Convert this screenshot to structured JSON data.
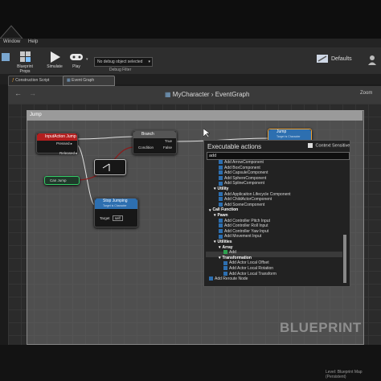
{
  "menu": [
    "Window",
    "Help"
  ],
  "toolbar": {
    "blueprint_props": "Blueprint Props",
    "simulate": "Simulate",
    "play": "Play",
    "debug_select": "No debug object selected",
    "debug_filter": "Debug Filter",
    "defaults": "Defaults"
  },
  "tabs": [
    "Construction Script",
    "Event Graph"
  ],
  "breadcrumb": {
    "root": "MyCharacter",
    "sep": "›",
    "leaf": "EventGraph"
  },
  "zoom_label": "Zoom",
  "comment": "Jump",
  "nodes": {
    "input_action": {
      "title": "InputAction Jump",
      "pressed": "Pressed",
      "released": "Released"
    },
    "branch": {
      "title": "Branch",
      "condition": "Condition",
      "true": "True",
      "false": "False"
    },
    "jump": {
      "title": "Jump",
      "subtitle": "Target is Character"
    },
    "stop_jumping": {
      "title": "Stop Jumping",
      "subtitle": "Target is Character",
      "target": "Target",
      "self": "self"
    },
    "can_jump": {
      "title": "Can Jump"
    }
  },
  "context_menu": {
    "title": "Executable actions",
    "context_sensitive": "Context Sensitive",
    "search": "add",
    "items": [
      {
        "text": "Add ArrowComponent",
        "level": 2,
        "type": "fn"
      },
      {
        "text": "Add BoxComponent",
        "level": 2,
        "type": "fn"
      },
      {
        "text": "Add CapsuleComponent",
        "level": 2,
        "type": "fn"
      },
      {
        "text": "Add SphereComponent",
        "level": 2,
        "type": "fn"
      },
      {
        "text": "Add SplineComponent",
        "level": 2,
        "type": "fn"
      },
      {
        "text": "Utility",
        "level": 1,
        "type": "hdr"
      },
      {
        "text": "Add Applicaiton Lifecycle Component",
        "level": 2,
        "type": "fn"
      },
      {
        "text": "Add ChildActorComponent",
        "level": 2,
        "type": "fn"
      },
      {
        "text": "Add SceneComponent",
        "level": 2,
        "type": "fn"
      },
      {
        "text": "Call Function",
        "level": 0,
        "type": "hdr"
      },
      {
        "text": "Pawn",
        "level": 1,
        "type": "hdr"
      },
      {
        "text": "Add Controller Pitch Input",
        "level": 2,
        "type": "fn"
      },
      {
        "text": "Add Controller Roll Input",
        "level": 2,
        "type": "fn"
      },
      {
        "text": "Add Controller Yaw Input",
        "level": 2,
        "type": "fn"
      },
      {
        "text": "Add Movement Input",
        "level": 2,
        "type": "fn"
      },
      {
        "text": "Utilities",
        "level": 1,
        "type": "hdr"
      },
      {
        "text": "Array",
        "level": 2,
        "type": "hdr"
      },
      {
        "text": "Add",
        "level": 3,
        "type": "fn"
      },
      {
        "text": "Transformation",
        "level": 2,
        "type": "hdr"
      },
      {
        "text": "Add Actor Local Offset",
        "level": 3,
        "type": "fn"
      },
      {
        "text": "Add Actor Local Rotation",
        "level": 3,
        "type": "fn"
      },
      {
        "text": "Add Actor Local Transform",
        "level": 3,
        "type": "fn"
      },
      {
        "text": "Add Reroute Node",
        "level": 0,
        "type": "fn"
      }
    ]
  },
  "watermark": "BLUEPRINT",
  "status": "Level: Blueprint Map (Persistent)",
  "colors": {
    "accent_orange": "#f0a030",
    "event_red": "#b21e1e",
    "fn_blue": "#2d6fb0",
    "highlight_green": "#2fa34f"
  }
}
